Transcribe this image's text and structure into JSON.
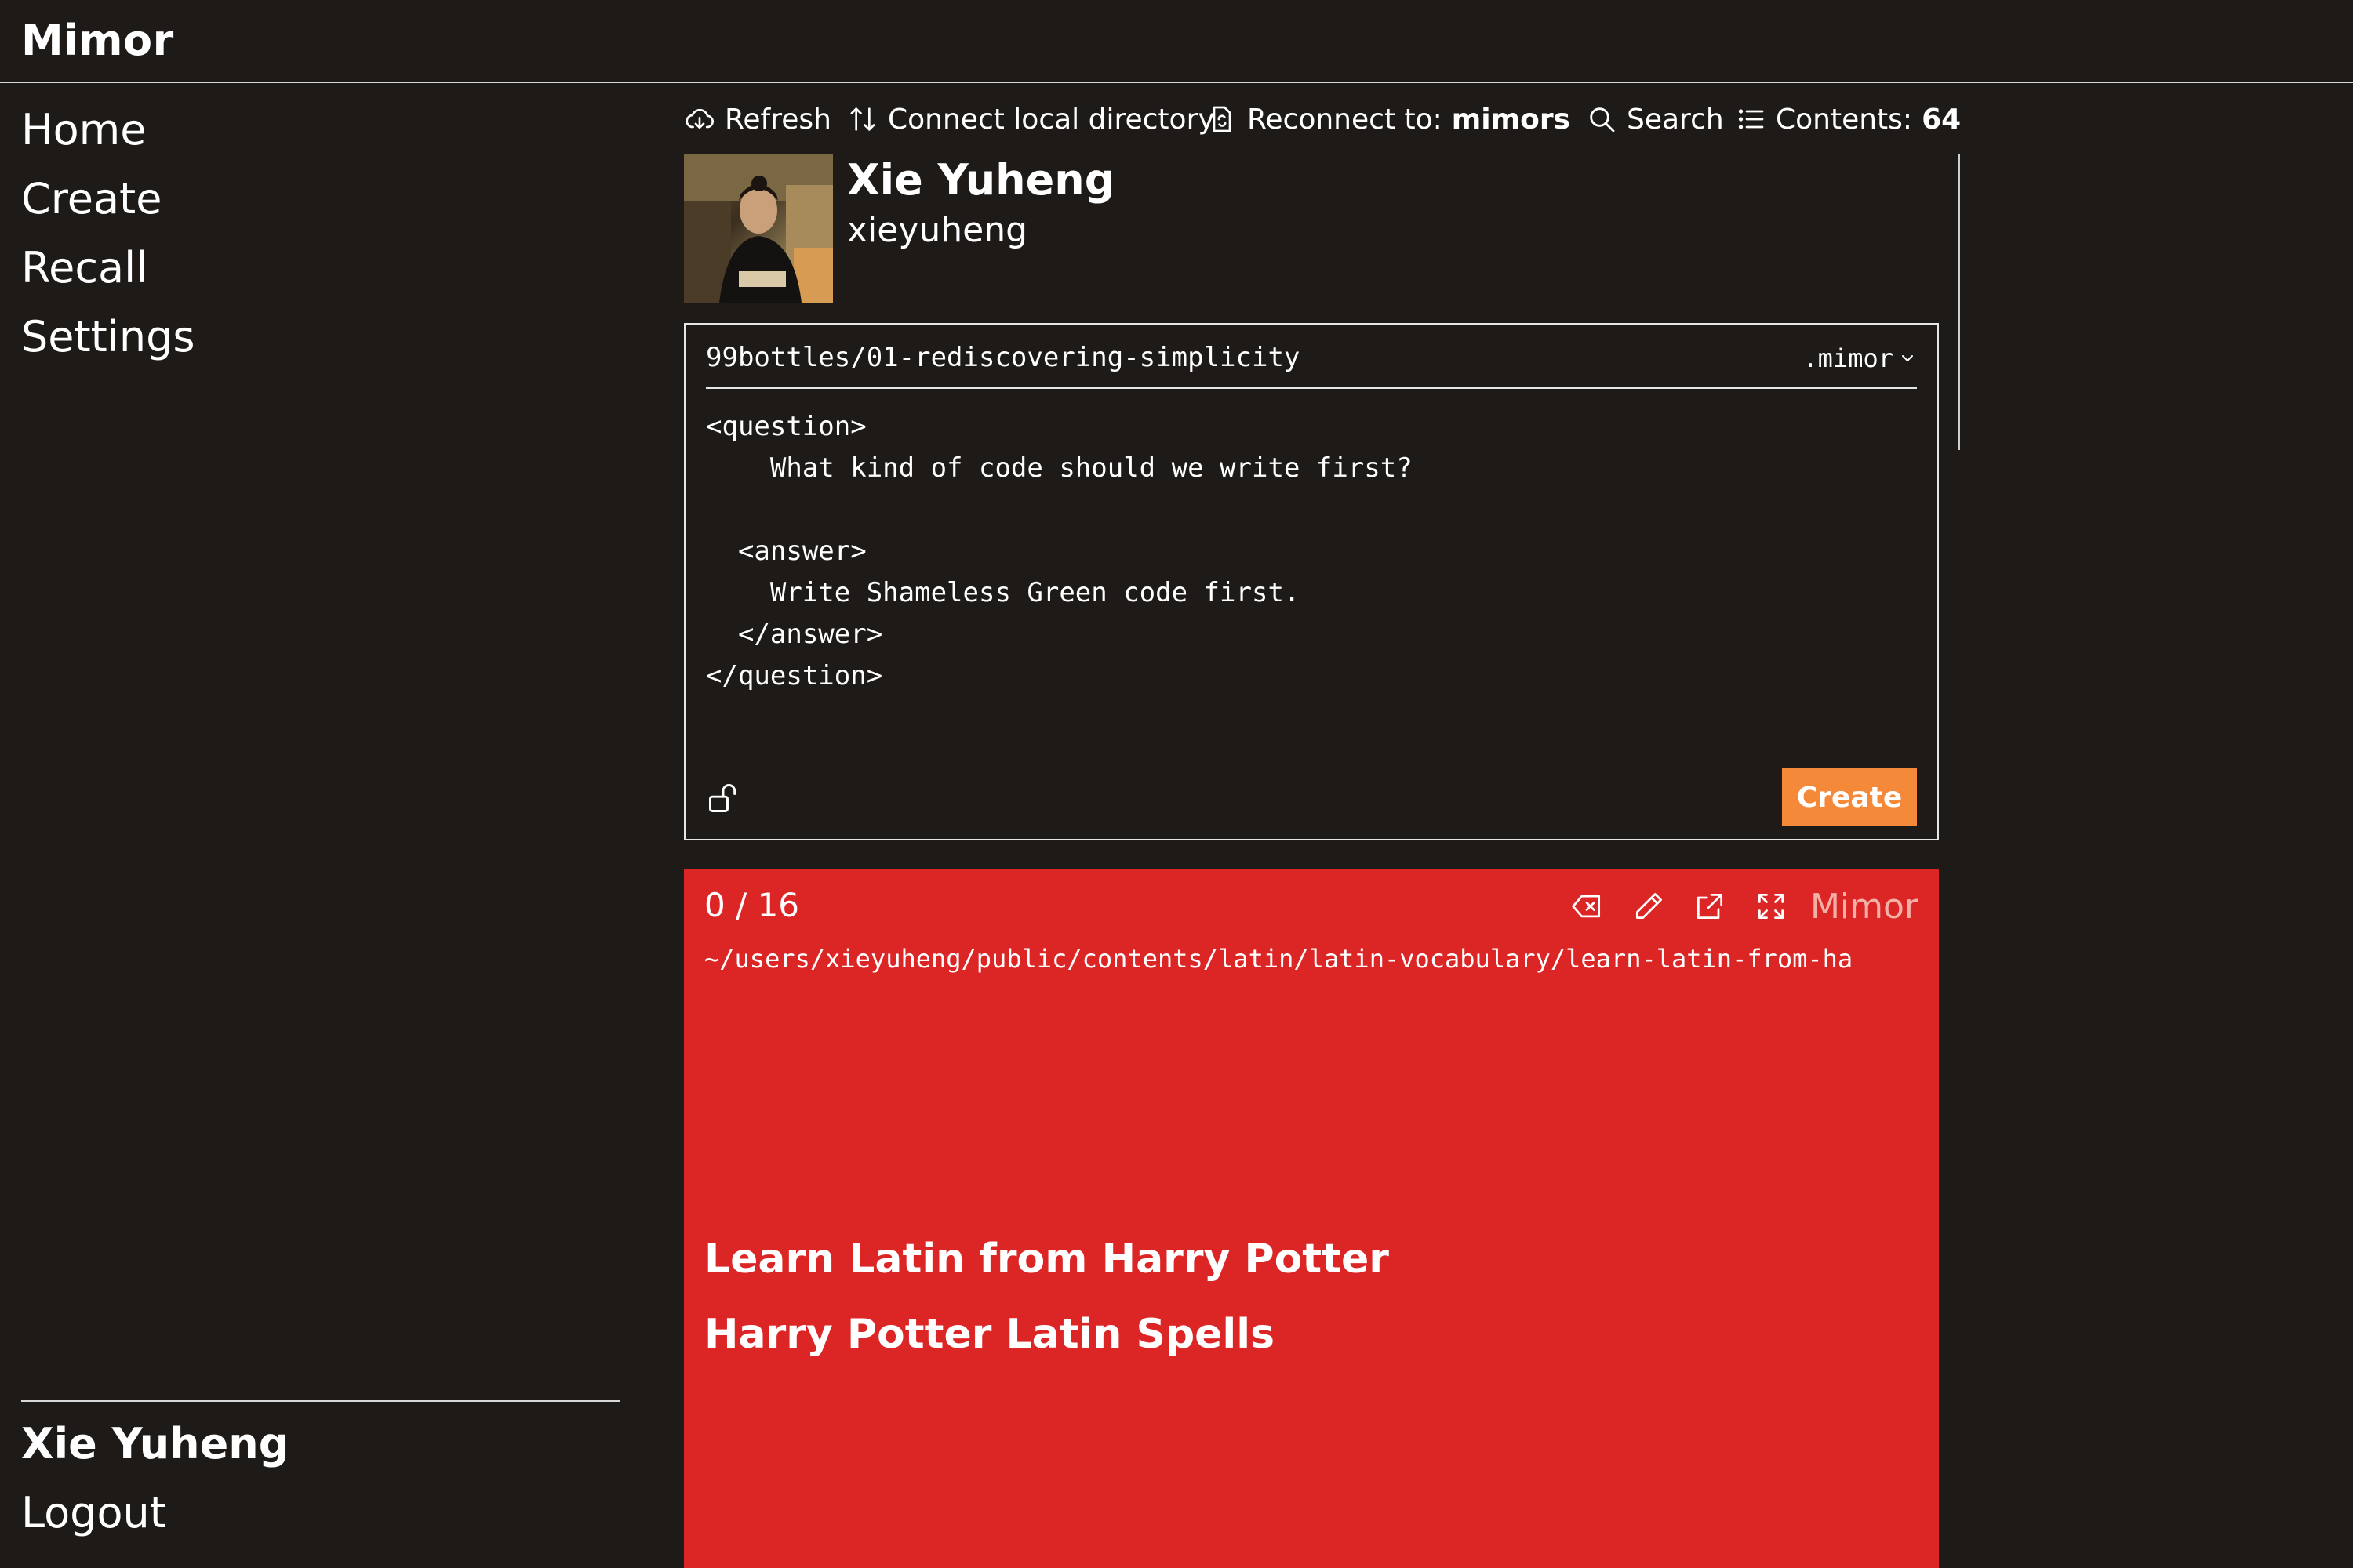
{
  "app": {
    "brand": "Mimor"
  },
  "sidebar": {
    "items": [
      {
        "label": "Home"
      },
      {
        "label": "Create"
      },
      {
        "label": "Recall"
      },
      {
        "label": "Settings"
      }
    ],
    "user_name": "Xie Yuheng",
    "logout_label": "Logout"
  },
  "toolbar": {
    "refresh_label": "Refresh",
    "connect_label": "Connect local directory",
    "reconnect_label": "Reconnect to:",
    "reconnect_target": "mimors",
    "search_label": "Search",
    "contents_label": "Contents:",
    "contents_count": "64"
  },
  "profile": {
    "name": "Xie Yuheng",
    "handle": "xieyuheng"
  },
  "editor": {
    "path": "99bottles/01-rediscovering-simplicity",
    "extension": ".mimor",
    "lines": [
      "<question>",
      "    What kind of code should we write first?",
      "",
      "  <answer>",
      "    Write Shameless Green code first.",
      "  </answer>",
      "</question>"
    ],
    "create_label": "Create"
  },
  "card": {
    "progress": "0 / 16",
    "brand": "Mimor",
    "path": "~/users/xieyuheng/public/contents/latin/latin-vocabulary/learn-latin-from-ha",
    "titles": [
      "Learn Latin from Harry Potter",
      "Harry Potter Latin Spells"
    ],
    "background": "#dc2626"
  },
  "colors": {
    "background": "#1e1a18",
    "accent": "#f4893a"
  }
}
